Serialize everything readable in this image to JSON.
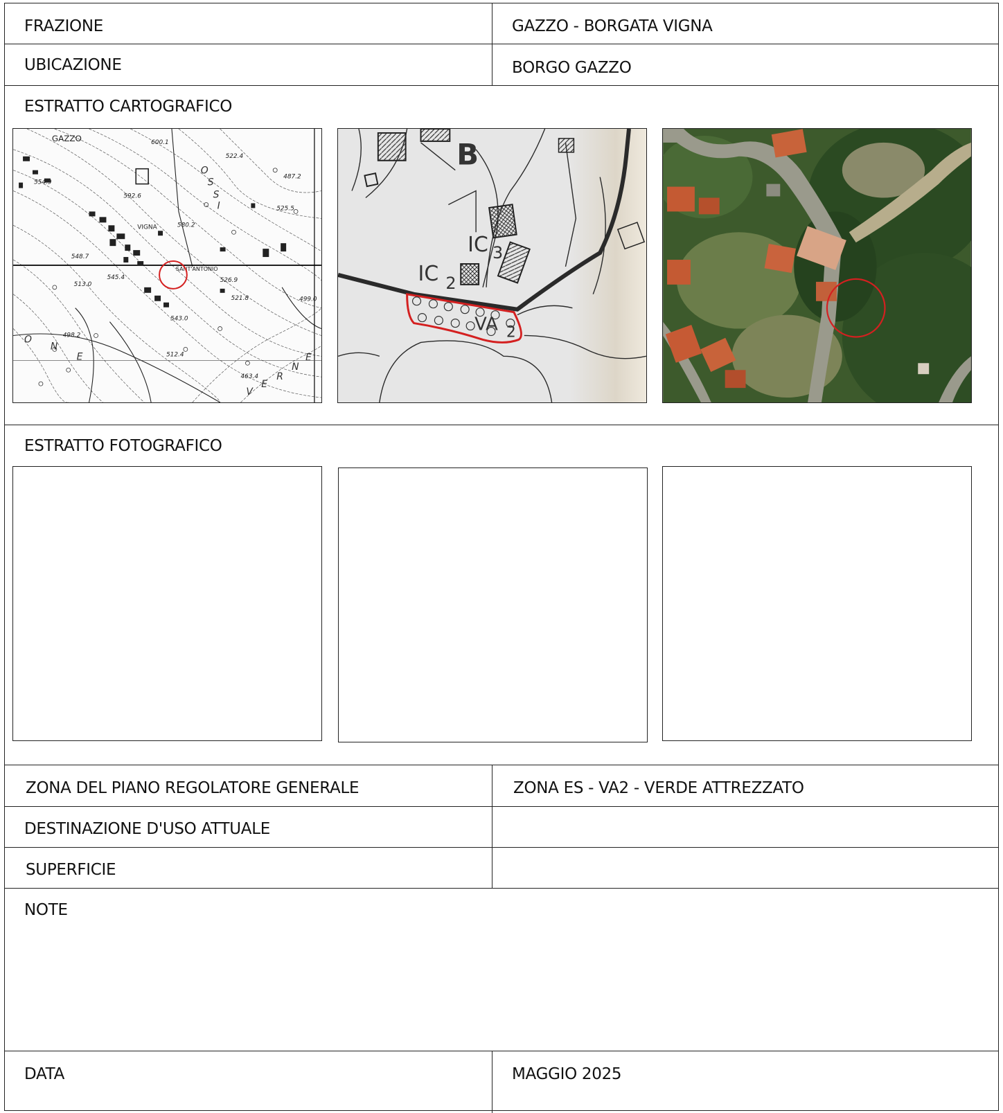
{
  "header": {
    "frazione_label": "FRAZIONE",
    "frazione_value": "GAZZO - BORGATA VIGNA",
    "ubicazione_label": "UBICAZIONE",
    "ubicazione_value": "BORGO GAZZO"
  },
  "cartografico": {
    "title": "ESTRATTO CARTOGRAFICO",
    "topo_labels": [
      "GAZZO",
      "VIGNA",
      "SANT'ANTONIO",
      "600.1",
      "592.6",
      "580.2",
      "554.9",
      "548.7",
      "545.4",
      "543.0",
      "526.9",
      "521.8",
      "513.0",
      "498.2",
      "487.2",
      "525.5",
      "522.4",
      "512.4",
      "463.4",
      "499.0"
    ],
    "topo_letters": [
      "O",
      "S",
      "S",
      "I",
      "O",
      "N",
      "E",
      "V",
      "E",
      "R",
      "N",
      "E"
    ],
    "cadastral_labels": {
      "zone": "B",
      "ic2": "IC",
      "ic2_sub": "2",
      "ic3": "IC",
      "ic3_sub": "3",
      "va": "VA",
      "va_sub": "2"
    },
    "highlight_color": "#d42020"
  },
  "fotografico": {
    "title": "ESTRATTO FOTOGRAFICO"
  },
  "details": {
    "zona_label": "ZONA DEL PIANO REGOLATORE GENERALE",
    "zona_value": "ZONA ES - VA2 - VERDE ATTREZZATO",
    "destinazione_label": "DESTINAZIONE D'USO ATTUALE",
    "destinazione_value": "",
    "superficie_label": "SUPERFICIE",
    "superficie_value": "",
    "note_label": "NOTE",
    "note_value": "",
    "data_label": "DATA",
    "data_value": "MAGGIO 2025"
  }
}
